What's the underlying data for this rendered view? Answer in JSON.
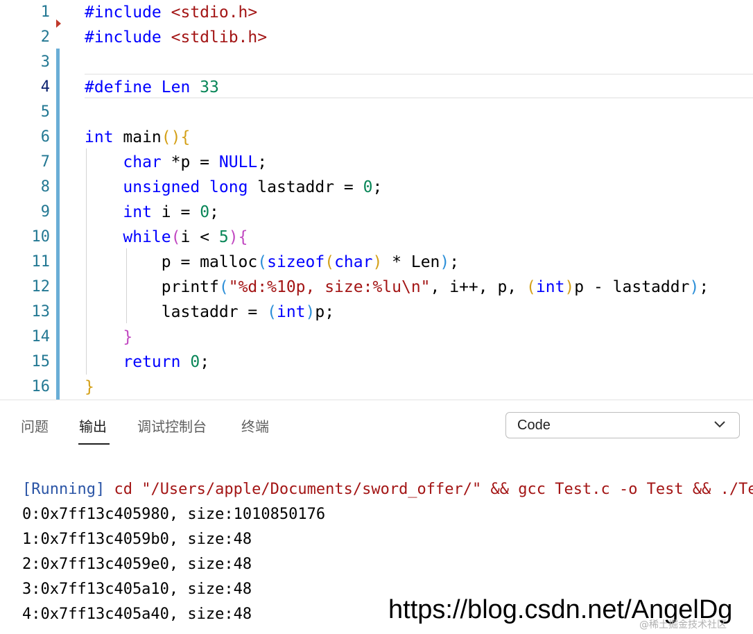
{
  "editor": {
    "line_numbers": [
      "1",
      "2",
      "3",
      "4",
      "5",
      "6",
      "7",
      "8",
      "9",
      "10",
      "11",
      "12",
      "13",
      "14",
      "15",
      "16"
    ],
    "lines": [
      [
        {
          "t": "#include ",
          "c": "kw"
        },
        {
          "t": "<stdio.h>",
          "c": "str"
        }
      ],
      [
        {
          "t": "#include ",
          "c": "kw"
        },
        {
          "t": "<stdlib.h>",
          "c": "str"
        }
      ],
      [],
      [
        {
          "t": "#define ",
          "c": "kw"
        },
        {
          "t": "Len ",
          "c": "kw"
        },
        {
          "t": "33",
          "c": "num"
        }
      ],
      [],
      [
        {
          "t": "int",
          "c": "kw"
        },
        {
          "t": " main",
          "c": ""
        },
        {
          "t": "()",
          "c": "br1"
        },
        {
          "t": "{",
          "c": "br1"
        }
      ],
      [
        {
          "t": "    ",
          "c": ""
        },
        {
          "t": "char",
          "c": "kw"
        },
        {
          "t": " *p = ",
          "c": ""
        },
        {
          "t": "NULL",
          "c": "kw"
        },
        {
          "t": ";",
          "c": ""
        }
      ],
      [
        {
          "t": "    ",
          "c": ""
        },
        {
          "t": "unsigned",
          "c": "kw"
        },
        {
          "t": " ",
          "c": ""
        },
        {
          "t": "long",
          "c": "kw"
        },
        {
          "t": " lastaddr = ",
          "c": ""
        },
        {
          "t": "0",
          "c": "num"
        },
        {
          "t": ";",
          "c": ""
        }
      ],
      [
        {
          "t": "    ",
          "c": ""
        },
        {
          "t": "int",
          "c": "kw"
        },
        {
          "t": " i = ",
          "c": ""
        },
        {
          "t": "0",
          "c": "num"
        },
        {
          "t": ";",
          "c": ""
        }
      ],
      [
        {
          "t": "    ",
          "c": ""
        },
        {
          "t": "while",
          "c": "kw"
        },
        {
          "t": "(",
          "c": "br2"
        },
        {
          "t": "i < ",
          "c": ""
        },
        {
          "t": "5",
          "c": "num"
        },
        {
          "t": ")",
          "c": "br2"
        },
        {
          "t": "{",
          "c": "br2"
        }
      ],
      [
        {
          "t": "        p = malloc",
          "c": ""
        },
        {
          "t": "(",
          "c": "br3"
        },
        {
          "t": "sizeof",
          "c": "kw"
        },
        {
          "t": "(",
          "c": "br1"
        },
        {
          "t": "char",
          "c": "kw"
        },
        {
          "t": ")",
          "c": "br1"
        },
        {
          "t": " * Len",
          "c": ""
        },
        {
          "t": ")",
          "c": "br3"
        },
        {
          "t": ";",
          "c": ""
        }
      ],
      [
        {
          "t": "        printf",
          "c": ""
        },
        {
          "t": "(",
          "c": "br3"
        },
        {
          "t": "\"%d:%10p, size:%lu\\n\"",
          "c": "str"
        },
        {
          "t": ", i++, p, ",
          "c": ""
        },
        {
          "t": "(",
          "c": "br1"
        },
        {
          "t": "int",
          "c": "kw"
        },
        {
          "t": ")",
          "c": "br1"
        },
        {
          "t": "p - lastaddr",
          "c": ""
        },
        {
          "t": ")",
          "c": "br3"
        },
        {
          "t": ";",
          "c": ""
        }
      ],
      [
        {
          "t": "        lastaddr = ",
          "c": ""
        },
        {
          "t": "(",
          "c": "br3"
        },
        {
          "t": "int",
          "c": "kw"
        },
        {
          "t": ")",
          "c": "br3"
        },
        {
          "t": "p;",
          "c": ""
        }
      ],
      [
        {
          "t": "    ",
          "c": ""
        },
        {
          "t": "}",
          "c": "br2"
        }
      ],
      [
        {
          "t": "    ",
          "c": ""
        },
        {
          "t": "return",
          "c": "kw"
        },
        {
          "t": " ",
          "c": ""
        },
        {
          "t": "0",
          "c": "num"
        },
        {
          "t": ";",
          "c": ""
        }
      ],
      [
        {
          "t": "}",
          "c": "br1"
        }
      ]
    ]
  },
  "panel": {
    "tabs": [
      "问题",
      "输出",
      "调试控制台",
      "终端"
    ],
    "active_tab": "输出",
    "dropdown_value": "Code"
  },
  "output": {
    "running_tag": "[Running]",
    "command": " cd \"/Users/apple/Documents/sword_offer/\" && gcc Test.c -o Test && ./Test",
    "lines": [
      "0:0x7ff13c405980, size:1010850176",
      "1:0x7ff13c4059b0, size:48",
      "2:0x7ff13c4059e0, size:48",
      "3:0x7ff13c405a10, size:48",
      "4:0x7ff13c405a40, size:48"
    ]
  },
  "watermark": "https://blog.csdn.net/AngelDg",
  "watermark_small": "@稀土掘金技术社区",
  "colors": {
    "keyword": "#0000ff",
    "string": "#a31515",
    "number": "#098658",
    "line_number": "#237893",
    "change_bar": "#6aaed6"
  }
}
